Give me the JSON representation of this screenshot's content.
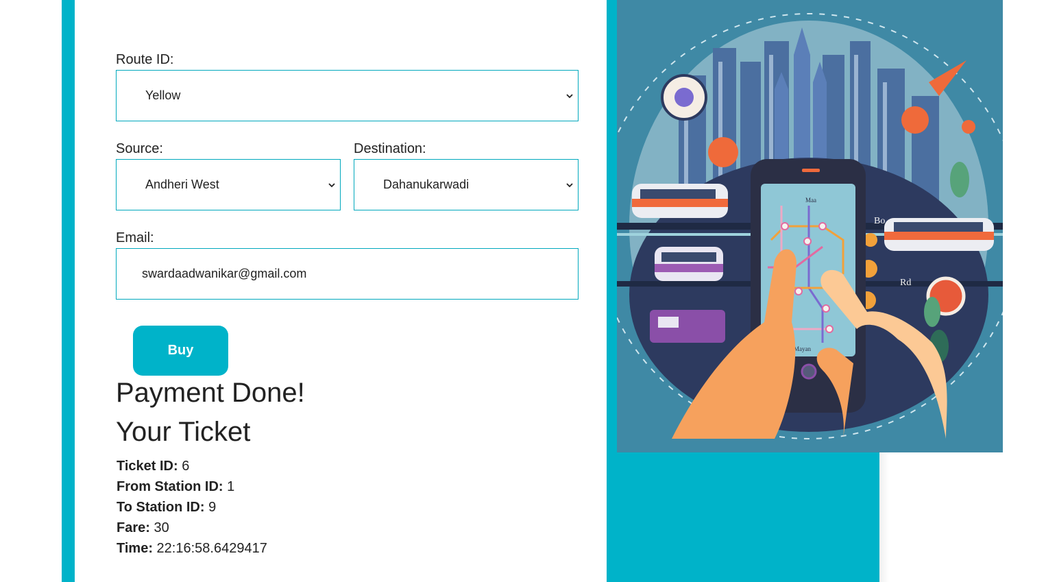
{
  "form": {
    "route_label": "Route ID:",
    "route_value": "Yellow",
    "source_label": "Source:",
    "source_value": "Andheri West",
    "destination_label": "Destination:",
    "destination_value": "Dahanukarwadi",
    "email_label": "Email:",
    "email_value": "swardaadwanikar@gmail.com",
    "buy_label": "Buy"
  },
  "result": {
    "payment_status": "Payment Done!",
    "ticket_heading": "Your Ticket",
    "fields": [
      {
        "label": "Ticket ID:",
        "value": "6"
      },
      {
        "label": "From Station ID:",
        "value": "1"
      },
      {
        "label": "To Station ID:",
        "value": "9"
      },
      {
        "label": "Fare:",
        "value": "30"
      },
      {
        "label": "Time:",
        "value": "22:16:58.6429417"
      }
    ]
  },
  "illustration": {
    "subject": "metro-map-phone-illustration",
    "map_labels": [
      "Bo",
      "Rd",
      "Maa",
      "Mayan"
    ]
  },
  "colors": {
    "accent": "#00b3c9",
    "border": "#00a8bd",
    "text": "#222222",
    "illustration_bg": "#3f89a5"
  }
}
